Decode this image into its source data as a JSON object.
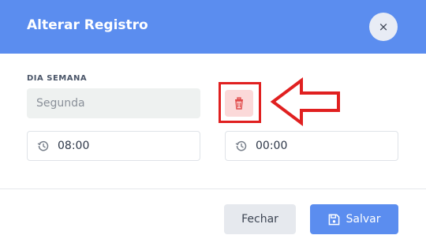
{
  "modal": {
    "title": "Alterar Registro",
    "close_glyph": "×"
  },
  "day_field": {
    "label": "DIA SEMANA",
    "value": "Segunda"
  },
  "time_fields": {
    "start": "08:00",
    "end": "00:00"
  },
  "footer": {
    "close_label": "Fechar",
    "save_label": "Salvar"
  },
  "colors": {
    "header": "#5b8def",
    "delete_bg": "#fbd9d9",
    "delete_icon": "#e04848",
    "annotation": "#e02020"
  },
  "icons": [
    "close-icon",
    "trash-icon",
    "history-icon",
    "save-icon",
    "arrow-annotation-icon"
  ]
}
